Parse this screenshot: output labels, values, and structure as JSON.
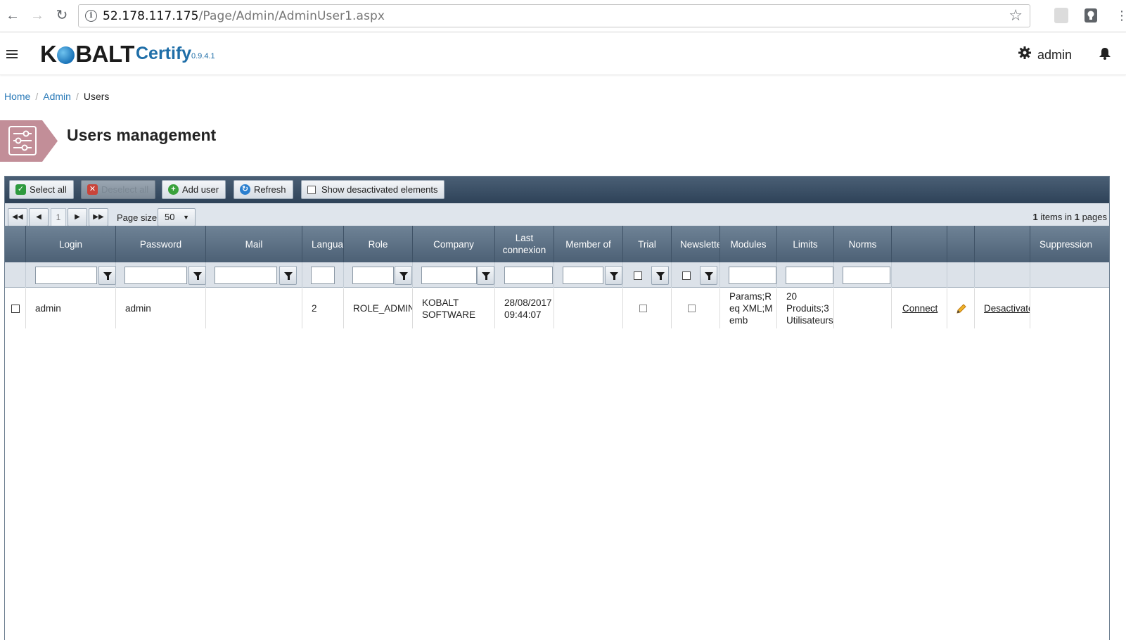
{
  "browser": {
    "url_host": "52.178.117.175",
    "url_path": "/Page/Admin/AdminUser1.aspx"
  },
  "header": {
    "logo_left": "K",
    "logo_right": "BALT",
    "product": "Certify",
    "version": "0.9.4.1",
    "user": "admin"
  },
  "breadcrumb": [
    "Home",
    "Admin",
    "Users"
  ],
  "page_title": "Users management",
  "toolbar": {
    "select_all": "Select all",
    "deselect_all": "Deselect all",
    "add_user": "Add user",
    "refresh": "Refresh",
    "show_deactivated": "Show desactivated elements"
  },
  "pager": {
    "current_page": "1",
    "page_size_label": "Page size:",
    "page_size": "50",
    "items_count": "1",
    "items_text": " items in ",
    "pages_count": "1",
    "pages_text": " pages"
  },
  "columns": [
    "Login",
    "Password",
    "Mail",
    "Language",
    "Role",
    "Company",
    "Last connexion",
    "Member of",
    "Trial",
    "Newsletter",
    "Modules",
    "Limits",
    "Norms",
    "",
    "",
    "",
    "Suppression"
  ],
  "rows": [
    {
      "login": "admin",
      "password": "admin",
      "mail": "",
      "language": "2",
      "role": "ROLE_ADMIN",
      "company": "KOBALT SOFTWARE",
      "last_connexion": "28/08/2017 09:44:07",
      "member_of": "",
      "modules": "Params;Req XML;Memb",
      "limits": "20 Produits;3 Utilisateurs;",
      "norms": "",
      "connect": "Connect",
      "deactivate": "Desactivate"
    }
  ],
  "colors": {
    "accent_blue": "#2a7ab8",
    "toolbar_dark": "#2e4258",
    "header_grey": "#5c7086",
    "title_badge": "#c28e98"
  }
}
